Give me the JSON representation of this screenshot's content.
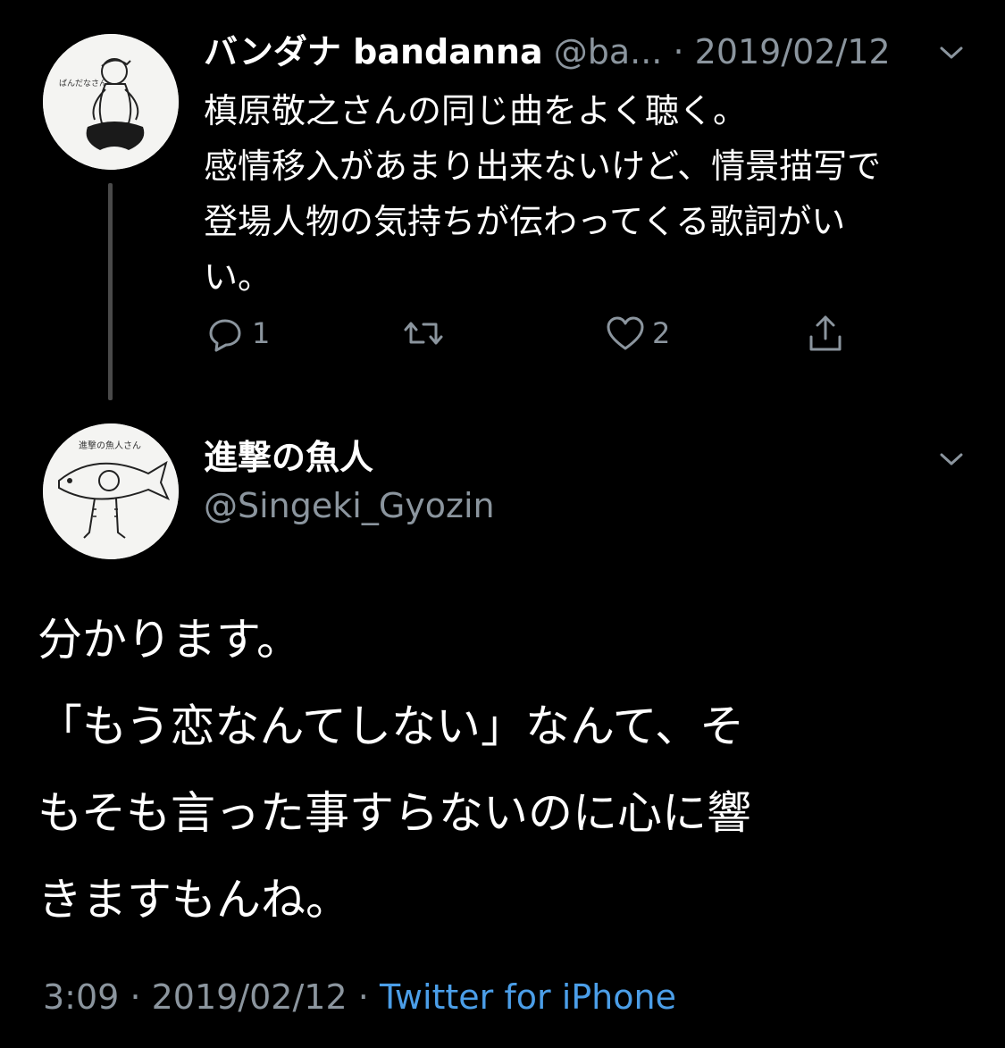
{
  "colors": {
    "background": "#000000",
    "primary_text": "#ffffff",
    "secondary_text": "#8b959e",
    "link": "#4b9ee8",
    "thread_line": "#4a4a4a"
  },
  "parent_tweet": {
    "display_name": "バンダナ bandanna",
    "handle": "@ba...",
    "separator": "·",
    "date": "2019/02/12",
    "menu_icon": "chevron-down-icon",
    "avatar_icon": "avatar-person-sketch",
    "avatar_caption": "ばんだなさん",
    "lines": [
      "槙原敬之さんの同じ曲をよく聴く。",
      "感情移入があまり出来ないけど、情景描写で",
      "登場人物の気持ちが伝わってくる歌詞がい",
      "い。"
    ],
    "actions": {
      "reply": {
        "icon": "reply-icon",
        "count": "1"
      },
      "retweet": {
        "icon": "retweet-icon"
      },
      "like": {
        "icon": "heart-icon",
        "count": "2"
      },
      "share": {
        "icon": "share-icon"
      }
    }
  },
  "reply_tweet": {
    "display_name": "進撃の魚人",
    "handle": "@Singeki_Gyozin",
    "menu_icon": "chevron-down-icon",
    "avatar_icon": "avatar-fish-sketch",
    "avatar_caption": "進撃の魚人さん",
    "lines": [
      "分かります。",
      "「もう恋なんてしない」なんて、そ",
      "もそも言った事すらないのに心に響",
      "きますもんね。"
    ],
    "time": "3:09",
    "separator": "·",
    "date": "2019/02/12",
    "source": "Twitter for iPhone"
  }
}
